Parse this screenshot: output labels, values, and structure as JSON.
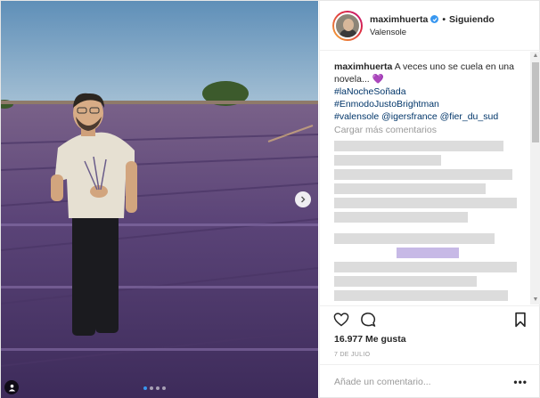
{
  "photo": {
    "description_icon": "user-tag-icon",
    "next_icon": "chevron-right-icon",
    "dots_count": 4,
    "active_dot": 0
  },
  "header": {
    "username": "maximhuerta",
    "verified_icon": "verified-badge-icon",
    "separator": "•",
    "follow_status": "Siguiendo",
    "location": "Valensole"
  },
  "caption": {
    "username": "maximhuerta",
    "text": "A veces uno se cuela en una novela...",
    "emoji": "💜",
    "hashtags": [
      "#laNocheSoñada",
      "#EnmodoJustoBrightman"
    ],
    "last_line": "#valensole @igersfrance @fier_du_sud"
  },
  "comments": {
    "load_more": "Cargar más comentarios"
  },
  "actions": {
    "like_icon": "heart-icon",
    "comment_icon": "comment-icon",
    "save_icon": "bookmark-icon"
  },
  "likes": "16.977 Me gusta",
  "date": "7 DE JULIO",
  "add_comment": {
    "placeholder": "Añade un comentario...",
    "more_label": "•••"
  },
  "colors": {
    "link": "#003569",
    "verified": "#3897f0",
    "muted": "#999999",
    "lavender": "#6a4f8e"
  }
}
